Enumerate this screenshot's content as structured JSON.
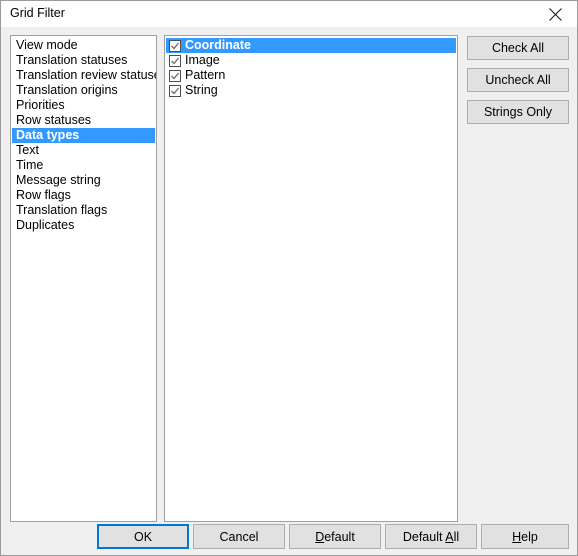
{
  "window": {
    "title": "Grid Filter",
    "close_icon": "close-icon"
  },
  "colors": {
    "selection_blue": "#3399ff",
    "focus_blue": "#0078d7",
    "dialog_bg": "#f0f0f0",
    "button_face": "#e1e1e1",
    "list_bg": "#ffffff",
    "border": "#a0a0a0"
  },
  "category_list": {
    "selected_index": 6,
    "items": [
      {
        "label": "View mode"
      },
      {
        "label": "Translation statuses"
      },
      {
        "label": "Translation review statuses"
      },
      {
        "label": "Translation origins"
      },
      {
        "label": "Priorities"
      },
      {
        "label": "Row statuses"
      },
      {
        "label": "Data types"
      },
      {
        "label": "Text"
      },
      {
        "label": "Time"
      },
      {
        "label": "Message string"
      },
      {
        "label": "Row flags"
      },
      {
        "label": "Translation flags"
      },
      {
        "label": "Duplicates"
      }
    ]
  },
  "items_list": {
    "selected_index": 0,
    "items": [
      {
        "label": "Coordinate",
        "checked": true
      },
      {
        "label": "Image",
        "checked": true
      },
      {
        "label": "Pattern",
        "checked": true
      },
      {
        "label": "String",
        "checked": true
      }
    ]
  },
  "side_buttons": {
    "check_all": "Check All",
    "uncheck_all": "Uncheck All",
    "strings_only": "Strings Only"
  },
  "bottom_buttons": {
    "ok": "OK",
    "cancel": "Cancel",
    "default_pre": "",
    "default_accel": "D",
    "default_post": "efault",
    "default_all_pre": "Default ",
    "default_all_accel": "A",
    "default_all_post": "ll",
    "help_pre": "",
    "help_accel": "H",
    "help_post": "elp"
  }
}
